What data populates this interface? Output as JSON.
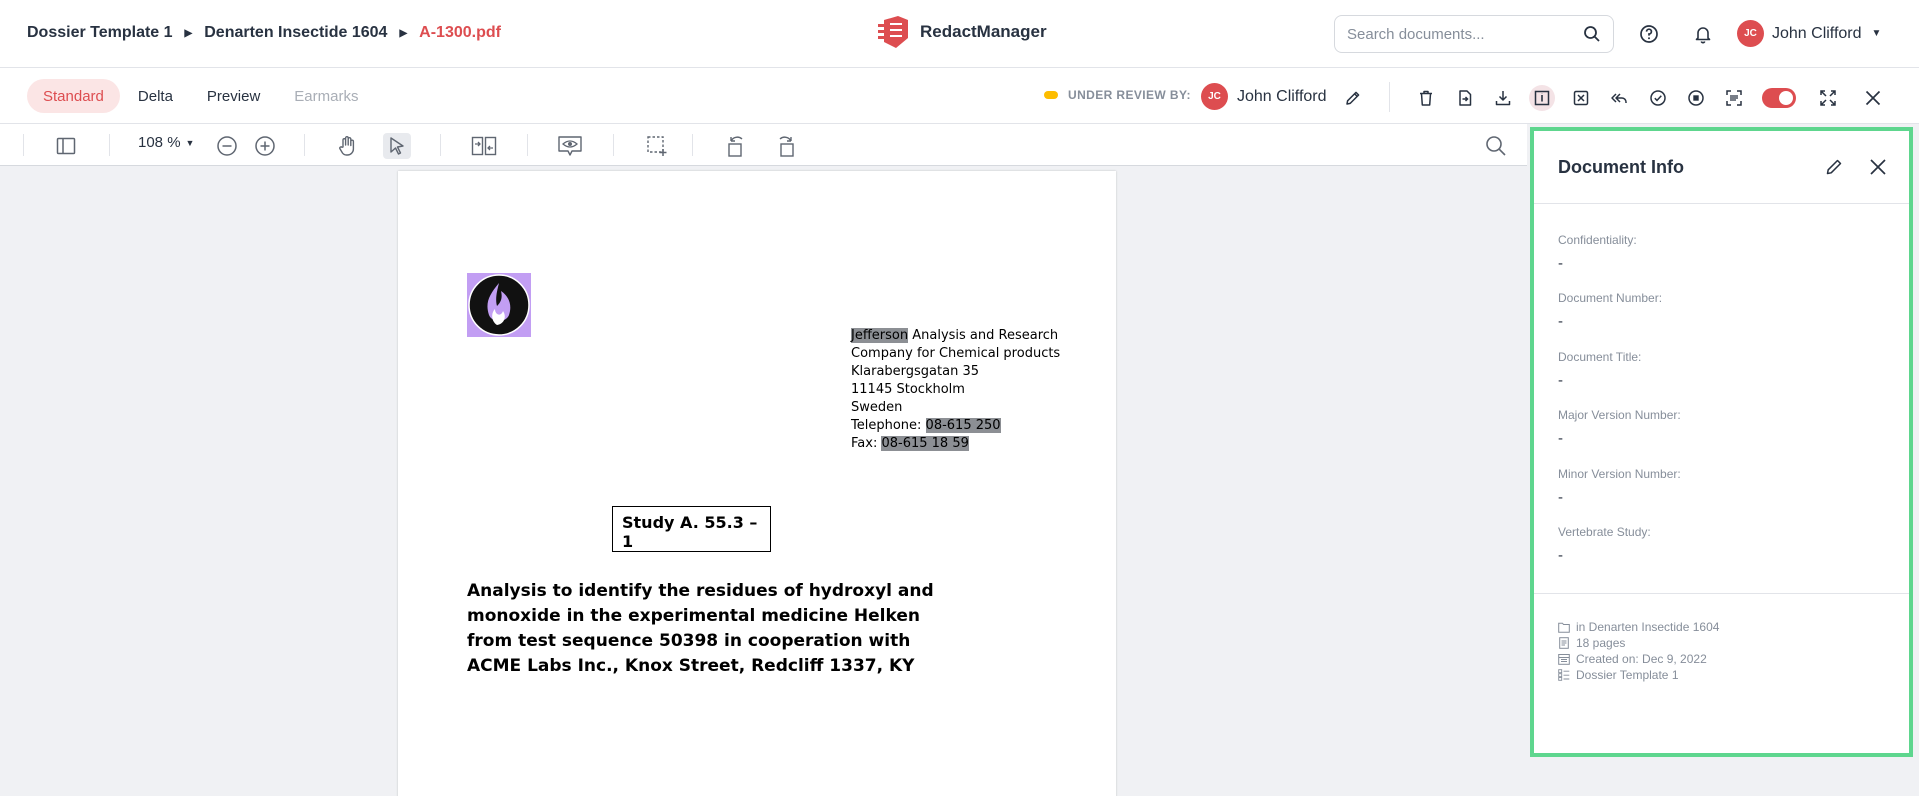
{
  "header": {
    "breadcrumb": [
      "Dossier Template 1",
      "Denarten Insectide 1604",
      "A-1300.pdf"
    ],
    "app_name": "RedactManager",
    "search_placeholder": "Search documents...",
    "user": {
      "initials": "JC",
      "name": "John Clifford"
    }
  },
  "modes": {
    "standard": "Standard",
    "delta": "Delta",
    "preview": "Preview",
    "earmarks": "Earmarks"
  },
  "status": {
    "label": "UNDER REVIEW BY:",
    "reviewer_initials": "JC",
    "reviewer_name": "John Clifford"
  },
  "viewer": {
    "zoom": "108 %"
  },
  "document": {
    "address": {
      "company_highlight": "Jefferson",
      "company_rest": " Analysis and Research Company for Chemical products",
      "street": "Klarabergsgatan 35",
      "city": "11145 Stockholm",
      "country": "Sweden",
      "tel_label": "Telephone: ",
      "tel_value": "08-615 250",
      "fax_label": "Fax: ",
      "fax_value": "08-615 18 59"
    },
    "study": "Study A. 55.3 – 1",
    "analysis": [
      "Analysis to identify the residues of hydroxyl and monoxide in the experimental medicine Helken",
      "from test sequence 50398 in cooperation with",
      "ACME Labs Inc., Knox Street, Redcliff 1337, KY"
    ]
  },
  "doc_info": {
    "title": "Document Info",
    "fields": [
      {
        "label": "Confidentiality:",
        "value": "-"
      },
      {
        "label": "Document Number:",
        "value": "-"
      },
      {
        "label": "Document Title:",
        "value": "-"
      },
      {
        "label": "Major Version Number:",
        "value": "-"
      },
      {
        "label": "Minor Version Number:",
        "value": "-"
      },
      {
        "label": "Vertebrate Study:",
        "value": "-"
      }
    ],
    "meta": {
      "dossier": "in Denarten Insectide 1604",
      "pages": "18 pages",
      "created": "Created on: Dec 9, 2022",
      "template": "Dossier Template 1"
    }
  },
  "colors": {
    "accent": "#dd4d50",
    "panel_outline": "#5ed68e",
    "status_dot": "#fdbd00"
  }
}
